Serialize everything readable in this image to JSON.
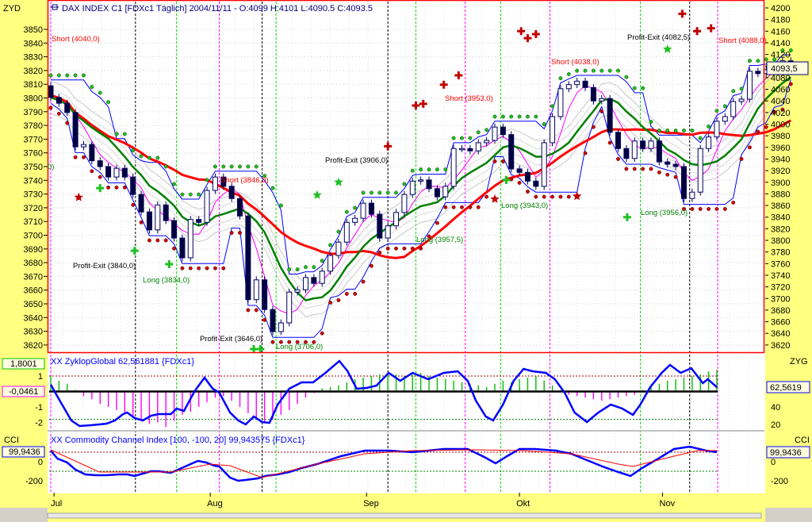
{
  "header": {
    "title": "DAX INDEX C1 [FDXc1  Täglich] 2004/11/11 - O:4099 H:4101 L:4090.5 C:4093.5",
    "left_axis_label": "ZYD",
    "last_price_box": "4093,5"
  },
  "oscillator": {
    "title": "XX ZyklopGlobal 62,561881 {FDXc1}",
    "right_label": "ZYG",
    "left_box_top": "1,8001",
    "left_box_mid": "-0,0461",
    "right_box": "62,5619"
  },
  "cci": {
    "title": "XX Commodity Channel Index [100, -100, 20] 99,943575 {FDXc1}",
    "left_label": "CCI",
    "right_label": "CCI",
    "left_box": "99,9436",
    "right_box": "99,9436"
  },
  "annotations": {
    "short_4040": "Short (4040,0)",
    "profit_3840": "Profit-Exit (3840,0)",
    "long_3834": "Long (3834,0)",
    "short_3846": "Short (3846,0)",
    "profit_3646": "Profit-Exit (3646,0)",
    "long_3706": "Long (3706,0)",
    "profit_3906": "Profit-Exit (3906,0)",
    "long_3957": "Long (3957,5)",
    "short_3953": "Short (3953,0)",
    "long_3943": "Long (3943,0)",
    "short_4038": "Short (4038,0)",
    "long_3956": "Long (3956,0)",
    "profit_4082": "Profit-Exit (4082,5)",
    "short_4088": "Short (4088,0)",
    "partial": "0)"
  },
  "chart_data": {
    "type": "candlestick",
    "title": "DAX INDEX C1 [FDXc1 Täglich] 2004/11/11",
    "x_unit": "trading day index (0 = 1 Jul 2004)",
    "x_months": [
      {
        "label": "Jul",
        "day": 0.4
      },
      {
        "label": "Aug",
        "day": 19.4
      },
      {
        "label": "Sep",
        "day": 38.4
      },
      {
        "label": "Okt",
        "day": 57
      },
      {
        "label": "Nov",
        "day": 74.4
      }
    ],
    "close": [
      4046,
      4036,
      4020,
      3961,
      3965,
      3937,
      3927,
      3909,
      3924,
      3909,
      3879,
      3849,
      3818,
      3861,
      3834,
      3804,
      3770,
      3836,
      3831,
      3886,
      3909,
      3893,
      3872,
      3842,
      3698,
      3732,
      3681,
      3643,
      3658,
      3711,
      3715,
      3736,
      3726,
      3747,
      3774,
      3797,
      3831,
      3838,
      3864,
      3845,
      3804,
      3825,
      3848,
      3879,
      3902,
      3904,
      3889,
      3875,
      3893,
      3958,
      3958,
      3954,
      3968,
      3972,
      3995,
      3982,
      3923,
      3917,
      3902,
      3893,
      3968,
      4013,
      4061,
      4068,
      4074,
      4063,
      4040,
      4044,
      3986,
      3958,
      3941,
      3971,
      3958,
      3971,
      3935,
      3931,
      3927,
      3872,
      3883,
      3958,
      3978,
      4005,
      4013,
      4039,
      4043,
      4091,
      4087,
      4093.5,
      4091,
      4109,
      4093.5
    ],
    "price_axis_right": {
      "ticks": [
        4200,
        4180,
        4160,
        4140,
        4120,
        4100,
        4080,
        4060,
        4040,
        4020,
        4000,
        3980,
        3960,
        3940,
        3920,
        3900,
        3880,
        3860,
        3840,
        3820,
        3800,
        3780,
        3760,
        3740,
        3720,
        3700,
        3680,
        3660,
        3640,
        3620
      ],
      "range": [
        3610,
        4210
      ]
    },
    "price_axis_left": {
      "ticks": [
        3850,
        3840,
        3830,
        3820,
        3810,
        3800,
        3790,
        3780,
        3770,
        3760,
        3750,
        3740,
        3730,
        3720,
        3710,
        3700,
        3690,
        3680,
        3670,
        3660,
        3650,
        3640,
        3630,
        3620
      ]
    },
    "signal_lines": {
      "magenta": [
        0,
        20.5,
        50.4,
        60.7,
        81.1
      ],
      "green": [
        15.3,
        27.4,
        44.4,
        54.7,
        71.7
      ],
      "black": [
        10.3,
        25.7,
        41,
        77.7
      ]
    },
    "markers": {
      "red_star": [
        [
          3.4,
          3874
        ],
        [
          54,
          3871
        ],
        [
          64,
          3876
        ]
      ],
      "green_star": [
        [
          32.4,
          3878
        ],
        [
          35,
          3900
        ],
        [
          75,
          4129
        ]
      ],
      "red_plus": [
        [
          41,
          3962
        ],
        [
          44.4,
          4032
        ],
        [
          45.3,
          4035
        ],
        [
          47.8,
          4068
        ],
        [
          49.6,
          4084
        ],
        [
          57.2,
          4160
        ],
        [
          58,
          4148
        ],
        [
          59,
          4155
        ],
        [
          76.8,
          4190
        ],
        [
          78.6,
          4160
        ],
        [
          80.3,
          4165
        ]
      ],
      "green_plus": [
        [
          6,
          3890
        ],
        [
          10.2,
          3782
        ],
        [
          14.4,
          3759
        ],
        [
          24.7,
          3613
        ],
        [
          25.5,
          3613
        ],
        [
          55.4,
          3904
        ],
        [
          70.1,
          3840
        ]
      ]
    },
    "zyklop": {
      "left_ticks": [
        1,
        0,
        -1,
        -2
      ],
      "right_ticks": [
        40,
        20
      ],
      "line_days": [
        0,
        1.1,
        2.5,
        3.5,
        4.9,
        5.9,
        6.8,
        7.8,
        8.8,
        9.3,
        10.2,
        11.2,
        12.2,
        13.1,
        14.6,
        15.3,
        16.2,
        17.5,
        18.7,
        19.7,
        20.5,
        21.8,
        22.8,
        23.7,
        24.7,
        25.7,
        26.6,
        27.6,
        29,
        30.5,
        31.9,
        33.4,
        35.1,
        36.1,
        37.2,
        38.4,
        39.6,
        41.1,
        42.5,
        44,
        45.9,
        47.8,
        49.5,
        50.7,
        51.7,
        52.9,
        53.8,
        55,
        56.3,
        57.5,
        58.6,
        60.2,
        61.3,
        62.5,
        63.7,
        65.2,
        66.6,
        68.1,
        69.5,
        70.8,
        71.7,
        72.9,
        74.3,
        75.3,
        76.6,
        77.9,
        79.3,
        79.9,
        81
      ],
      "line_values": [
        65.5,
        47.3,
        24.5,
        18.2,
        19.1,
        20,
        20.9,
        24.5,
        31.8,
        33.6,
        27.3,
        24.5,
        30,
        31.8,
        31.8,
        38.2,
        35.5,
        58.2,
        73.6,
        60.9,
        56.4,
        33.6,
        24.5,
        20,
        29.1,
        22.7,
        21.8,
        42.7,
        60.9,
        68.2,
        68.2,
        79.1,
        92.7,
        80.9,
        60.9,
        61.8,
        64.5,
        79.1,
        70,
        79.1,
        71.8,
        79.1,
        80.9,
        70,
        47.3,
        29.1,
        24.5,
        42.7,
        70,
        83.6,
        80.9,
        79.1,
        71.8,
        56.4,
        33.6,
        22.7,
        33.6,
        42.7,
        38.2,
        30.9,
        42.7,
        62.7,
        79.1,
        88.2,
        79.1,
        84.5,
        67.3,
        71.8,
        62.6
      ],
      "histogram": [
        1.0,
        0.7,
        0.5,
        0.1,
        -0.3,
        -0.5,
        -0.8,
        -1.0,
        -1.2,
        -1.5,
        -1.7,
        -1.9,
        -2.1,
        -2.0,
        -2.3,
        -1.9,
        -1.5,
        -1.3,
        -1.0,
        -0.7,
        -0.4,
        -0.3,
        -0.6,
        -1.0,
        -1.4,
        -1.8,
        -2.0,
        -1.8,
        -1.5,
        -1.2,
        -0.8,
        -0.4,
        -0.1,
        0.2,
        0.3,
        0.4,
        0.6,
        0.8,
        0.9,
        1.0,
        1.1,
        1.2,
        1.1,
        1.0,
        1.1,
        1.2,
        1.0,
        0.9,
        0.8,
        0.7,
        0.6,
        0.5,
        0.4,
        0.3,
        0.5,
        0.7,
        0.6,
        0.8,
        0.9,
        1.0,
        0.7,
        0.4,
        0.1,
        -0.2,
        -0.3,
        -0.4,
        -0.5,
        -0.6,
        -0.5,
        -0.4,
        -0.3,
        -0.2,
        0.1,
        0.3,
        0.5,
        0.7,
        0.8,
        0.9,
        1.0,
        1.1,
        1.3,
        1.4
      ],
      "upper_level": 1,
      "lower_level": -1.8
    },
    "cci_series": {
      "left_ticks": [
        0,
        -200
      ],
      "right_ticks": [
        0,
        -200
      ],
      "upper_level": 100,
      "lower_level": -100,
      "line_days": [
        0,
        0.8,
        2,
        3,
        4.2,
        5.4,
        6.8,
        8.3,
        9.3,
        10.2,
        11.2,
        12.2,
        13.1,
        14.6,
        15.5,
        17,
        17.9,
        18.9,
        19.9,
        20.5,
        21.8,
        22.8,
        23.7,
        25.2,
        26.1,
        27.6,
        29,
        30.5,
        32.4,
        35.3,
        38.2,
        41.1,
        44,
        47.8,
        50.7,
        52.7,
        54.1,
        55.5,
        57,
        58.9,
        61.4,
        63.3,
        65.2,
        67.1,
        69,
        70.5,
        71.9,
        73.9,
        75.8,
        77.7,
        79.7,
        81
      ],
      "line_values": [
        117,
        33,
        -8,
        -83,
        -133,
        -142,
        -142,
        -133,
        -133,
        -150,
        -125,
        -100,
        -100,
        -117,
        -83,
        -25,
        8,
        -8,
        -42,
        -50,
        -167,
        -200,
        -192,
        -175,
        -150,
        -133,
        -108,
        -67,
        -25,
        58,
        117,
        117,
        100,
        133,
        133,
        50,
        -17,
        58,
        133,
        133,
        117,
        83,
        17,
        -50,
        -108,
        -150,
        -67,
        33,
        133,
        158,
        117,
        100
      ],
      "signal_days": [
        0,
        5.9,
        14.6,
        19.4,
        21.8,
        25.7,
        32.4,
        38.2,
        44,
        51.7,
        57.5,
        63.3,
        69,
        70.8,
        75.8,
        78.7,
        81
      ],
      "signal_values": [
        125,
        -108,
        -108,
        -25,
        -42,
        -167,
        -25,
        83,
        117,
        125,
        117,
        83,
        -25,
        -50,
        58,
        117,
        117
      ]
    },
    "colors": {
      "axis_panel": "#ffff80",
      "bear_candle": "#000040",
      "ma_long": "#ff0000",
      "ma_short": "#008000",
      "band": "#0000ff",
      "inner": "#ff00ff"
    }
  }
}
